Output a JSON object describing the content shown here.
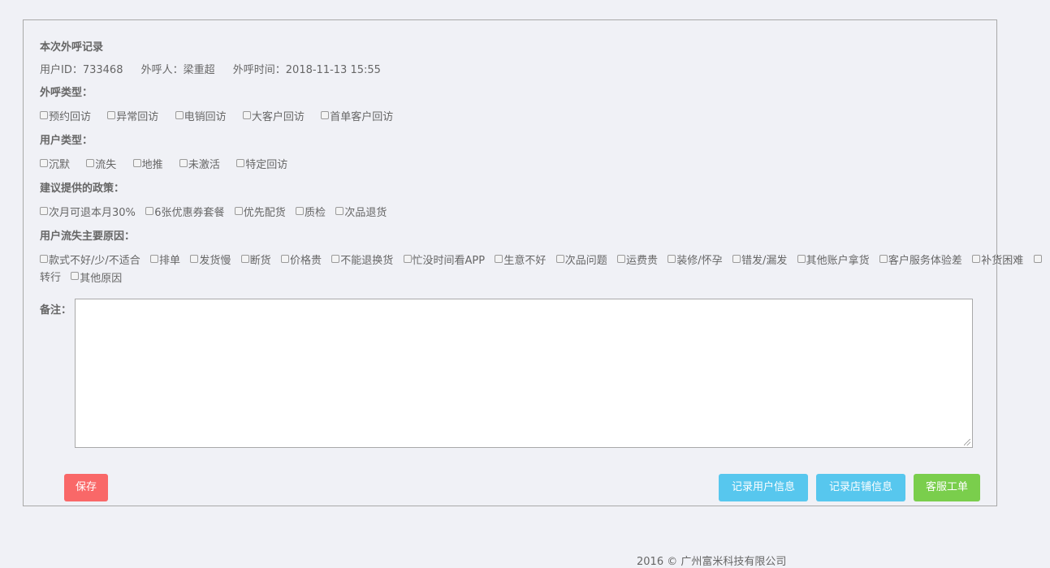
{
  "record": {
    "title": "本次外呼记录",
    "user_id": "用户ID：733468",
    "caller": "外呼人：梁重超",
    "call_time": "外呼时间：2018-11-13 15:55"
  },
  "call_type": {
    "label": "外呼类型：",
    "options": [
      "预约回访",
      "异常回访",
      "电销回访",
      "大客户回访",
      "首单客户回访"
    ]
  },
  "user_type": {
    "label": "用户类型：",
    "options": [
      "沉默",
      "流失",
      "地推",
      "未激活",
      "特定回访"
    ]
  },
  "policy": {
    "label": "建议提供的政策：",
    "options": [
      "次月可退本月30%",
      "6张优惠券套餐",
      "优先配货",
      "质检",
      "次品退货"
    ]
  },
  "churn_reason": {
    "label": "用户流失主要原因：",
    "options": [
      "款式不好/少/不适合",
      "排单",
      "发货慢",
      "断货",
      "价格贵",
      "不能退换货",
      "忙没时间看APP",
      "生意不好",
      "次品问题",
      "运费贵",
      "装修/怀孕",
      "错发/漏发",
      "其他账户拿货",
      "客户服务体验差",
      "补货困难",
      "转行",
      "其他原因"
    ]
  },
  "remark": {
    "label": "备注：",
    "value": ""
  },
  "buttons": {
    "save": "保存",
    "record_user": "记录用户信息",
    "record_shop": "记录店铺信息",
    "service_ticket": "客服工单"
  },
  "colors": {
    "save": "#f96868",
    "info": "#57c7ee",
    "success": "#7ace4c",
    "background": "#f0f1f6"
  },
  "footer": "2016 © 广州富米科技有限公司"
}
